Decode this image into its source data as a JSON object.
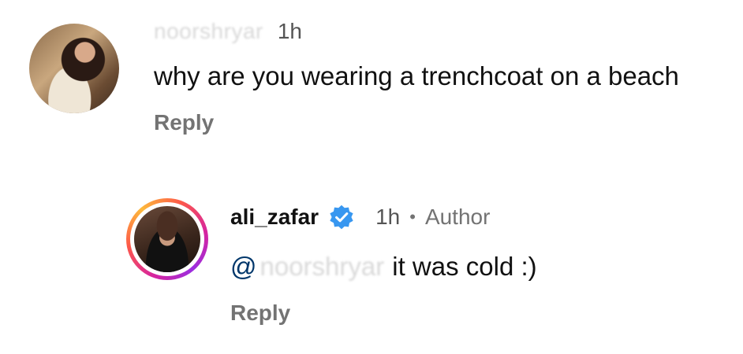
{
  "comments": [
    {
      "username": "noorshryar",
      "time": "1h",
      "text": "why are you wearing a trenchcoat on a beach",
      "reply_label": "Reply"
    },
    {
      "username": "ali_zafar",
      "verified": true,
      "time": "1h",
      "separator": "•",
      "badge": "Author",
      "mention_at": "@",
      "mention_user": "noorshryar",
      "text": "it was cold :)",
      "reply_label": "Reply"
    }
  ],
  "colors": {
    "verified_badge": "#3897f0",
    "mention": "#00376b",
    "secondary_text": "#737373"
  }
}
